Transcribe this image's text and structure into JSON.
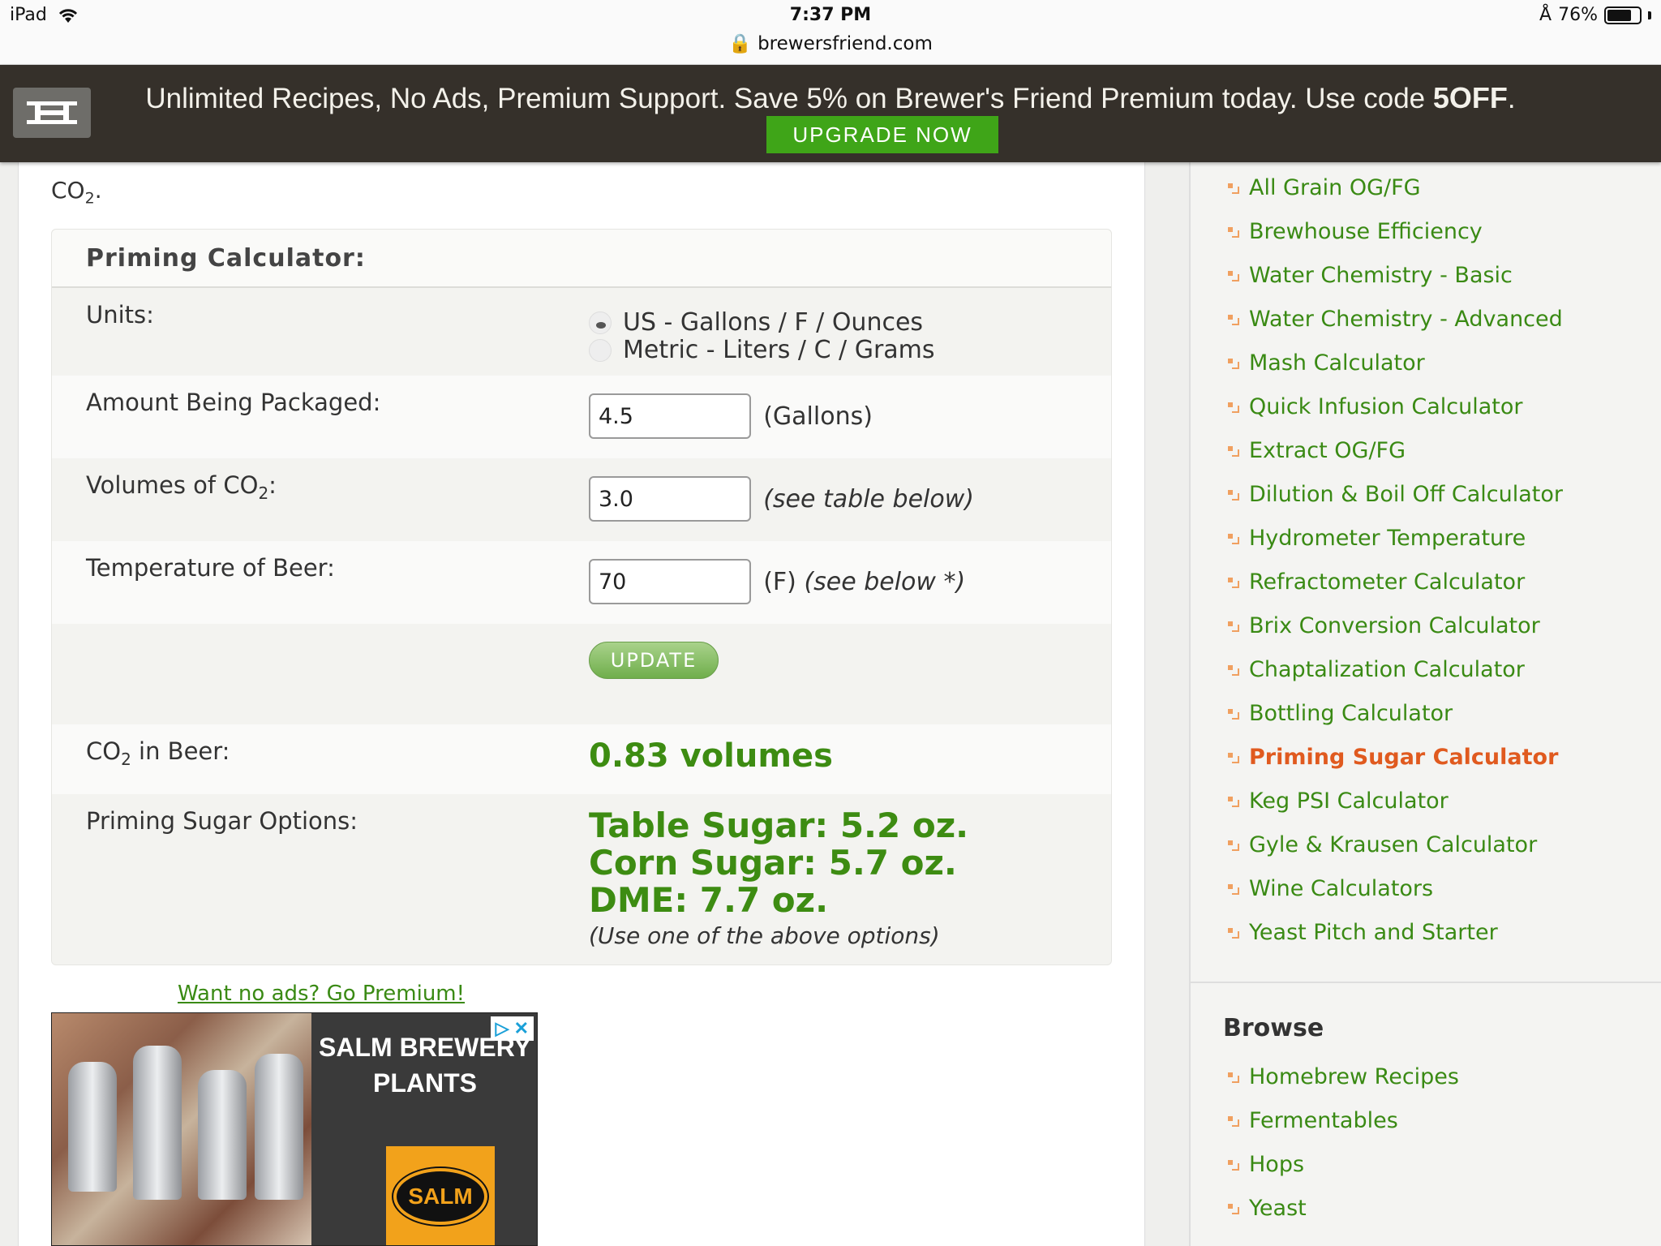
{
  "status_bar": {
    "device": "iPad",
    "time": "7:37 PM",
    "url": "brewersfriend.com",
    "battery": "76%",
    "battery_level": 0.76
  },
  "promo": {
    "text": "Unlimited Recipes, No Ads, Premium Support.  Save 5% on Brewer's Friend Premium today. Use code",
    "code": "5OFF",
    "period": ".",
    "button": "UPGRADE NOW"
  },
  "intro": {
    "text_pre": "CO",
    "sub": "2",
    "text_post": "."
  },
  "calculator": {
    "title": "Priming Calculator:",
    "units_label": "Units:",
    "unit_options": [
      "US - Gallons / F / Ounces",
      "Metric - Liters / C / Grams"
    ],
    "amount_label": "Amount Being Packaged:",
    "amount_value": "4.5",
    "amount_unit": "(Gallons)",
    "volumes_label_pre": "Volumes of CO",
    "volumes_label_sub": "2",
    "volumes_label_post": ":",
    "volumes_value": "3.0",
    "volumes_hint": "(see table below)",
    "temp_label": "Temperature of Beer:",
    "temp_value": "70",
    "temp_unit": "(F)",
    "temp_hint": "(see below *)",
    "update_button": "UPDATE",
    "co2_label_pre": "CO",
    "co2_label_sub": "2",
    "co2_label_post": " in Beer:",
    "co2_result": "0.83 volumes",
    "sugar_label": "Priming Sugar Options:",
    "sugar_options": [
      "Table Sugar: 5.2 oz.",
      "Corn Sugar: 5.7 oz.",
      "DME: 7.7 oz."
    ],
    "sugar_note": "(Use one of the above options)"
  },
  "premium_link": "Want no ads? Go Premium!",
  "ad": {
    "title_line1": "SALM BREWERY",
    "title_line2": "PLANTS",
    "logo": "SALM"
  },
  "sidebar": {
    "calculators": [
      "All Grain OG/FG",
      "Brewhouse Efficiency",
      "Water Chemistry - Basic",
      "Water Chemistry - Advanced",
      "Mash Calculator",
      "Quick Infusion Calculator",
      "Extract OG/FG",
      "Dilution & Boil Off Calculator",
      "Hydrometer Temperature",
      "Refractometer Calculator",
      "Brix Conversion Calculator",
      "Chaptalization Calculator",
      "Bottling Calculator",
      "Priming Sugar Calculator",
      "Keg PSI Calculator",
      "Gyle & Krausen Calculator",
      "Wine Calculators",
      "Yeast Pitch and Starter"
    ],
    "active_index": 13,
    "browse_title": "Browse",
    "browse": [
      "Homebrew Recipes",
      "Fermentables",
      "Hops",
      "Yeast"
    ]
  },
  "colors": {
    "accent_green": "#3d8c12",
    "active_link": "#e05a1f",
    "banner_bg": "#35302a",
    "upgrade_bg": "#3fa518"
  }
}
